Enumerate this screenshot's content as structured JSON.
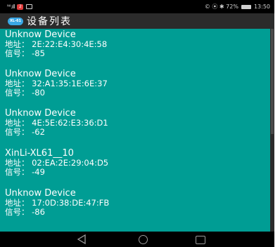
{
  "status_bar": {
    "signal": "ᴺᴬ.ıll",
    "badge": "2",
    "right_text": "© ⦿ ✱ 72%",
    "time": "13:50"
  },
  "app_bar": {
    "logo": "XL-61",
    "title": "设备列表"
  },
  "devices": [
    {
      "name": "Unknow Device",
      "addr_label": "地址：",
      "addr": "2E:22:E4:30:4E:58",
      "sig_label": "信号：",
      "sig": "-85"
    },
    {
      "name": "Unknow Device",
      "addr_label": "地址：",
      "addr": "32:A1:35:1E:6E:37",
      "sig_label": "信号：",
      "sig": "-80"
    },
    {
      "name": "Unknow Device",
      "addr_label": "地址：",
      "addr": "4E:5E:62:E3:36:D1",
      "sig_label": "信号：",
      "sig": "-62"
    },
    {
      "name": "XinLi-XL61__10",
      "addr_label": "地址：",
      "addr": "02:EA:2E:29:04:D5",
      "sig_label": "信号：",
      "sig": "-49"
    },
    {
      "name": "Unknow Device",
      "addr_label": "地址：",
      "addr": "17:0D:38:DE:47:FB",
      "sig_label": "信号：",
      "sig": "-86"
    }
  ],
  "colors": {
    "list_bg": "#009d94",
    "app_bar_bg": "#2b2b2b"
  }
}
